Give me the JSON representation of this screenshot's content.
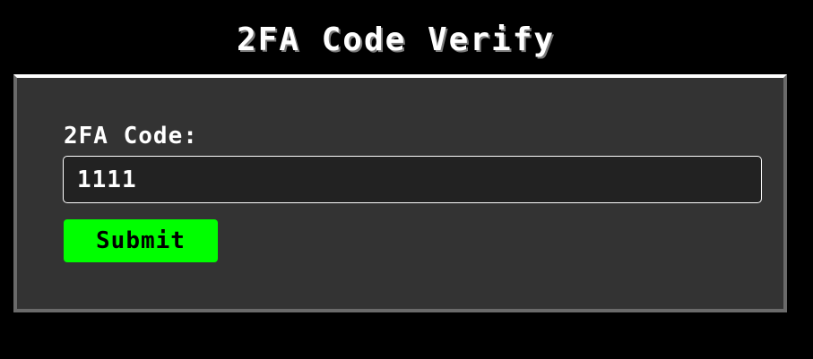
{
  "page": {
    "title": "2FA Code Verify"
  },
  "form": {
    "code_label": "2FA Code:",
    "code_value": "1111",
    "submit_label": "Submit"
  },
  "colors": {
    "background": "#000000",
    "panel": "#333333",
    "input_background": "#222222",
    "submit_button": "#00ff00"
  }
}
